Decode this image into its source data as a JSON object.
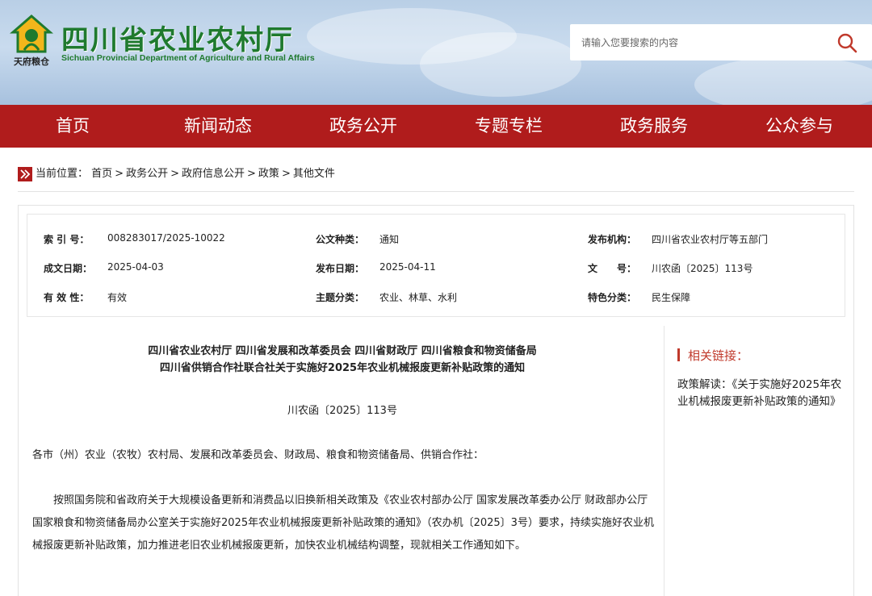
{
  "header": {
    "title": "四川省农业农村厅",
    "subtitle": "Sichuan Provincial Department of Agriculture and Rural Affairs",
    "logo_text": "天府粮仓",
    "search_placeholder": "请输入您要搜索的内容",
    "title_color": "#1f7a2e"
  },
  "nav": {
    "color": "#b01c1c",
    "items": [
      "首页",
      "新闻动态",
      "政务公开",
      "专题专栏",
      "政务服务",
      "公众参与"
    ]
  },
  "breadcrumb": {
    "prefix": "当前位置：",
    "items": [
      "首页",
      "政务公开",
      "政府信息公开",
      "政策",
      "其他文件"
    ],
    "separator": ">"
  },
  "meta": {
    "index_label": "索 引 号：",
    "index_value": "008283017/2025-10022",
    "doctype_label": "公文种类：",
    "doctype_value": "通知",
    "issuer_label": "发布机构：",
    "issuer_value": "四川省农业农村厅等五部门",
    "created_label": "成文日期：",
    "created_value": "2025-04-03",
    "published_label": "发布日期：",
    "published_value": "2025-04-11",
    "docno_label": "文　　号：",
    "docno_value": "川农函〔2025〕113号",
    "valid_label": "有 效 性：",
    "valid_value": "有效",
    "topic_label": "主题分类：",
    "topic_value": "农业、林草、水利",
    "feature_label": "特色分类：",
    "feature_value": "民生保障"
  },
  "article": {
    "title_line1": "四川省农业农村厅 四川省发展和改革委员会  四川省财政厅 四川省粮食和物资储备局",
    "title_line2": "四川省供销合作社联合社关于实施好2025年农业机械报废更新补贴政策的通知",
    "doc_no": "川农函〔2025〕113号",
    "salutation": "各市（州）农业（农牧）农村局、发展和改革委员会、财政局、粮食和物资储备局、供销合作社：",
    "body": "按照国务院和省政府关于大规模设备更新和消费品以旧换新相关政策及《农业农村部办公厅 国家发展改革委办公厅 财政部办公厅 国家粮食和物资储备局办公室关于实施好2025年农业机械报废更新补贴政策的通知》（农办机〔2025〕3号）要求，持续实施好农业机械报废更新补贴政策，加力推进老旧农业机械报废更新，加快农业机械结构调整，现就相关工作通知如下。"
  },
  "sidebar": {
    "title": "相关链接：",
    "link": "政策解读：《关于实施好2025年农业机械报废更新补贴政策的通知》",
    "accent": "#c0392b"
  }
}
